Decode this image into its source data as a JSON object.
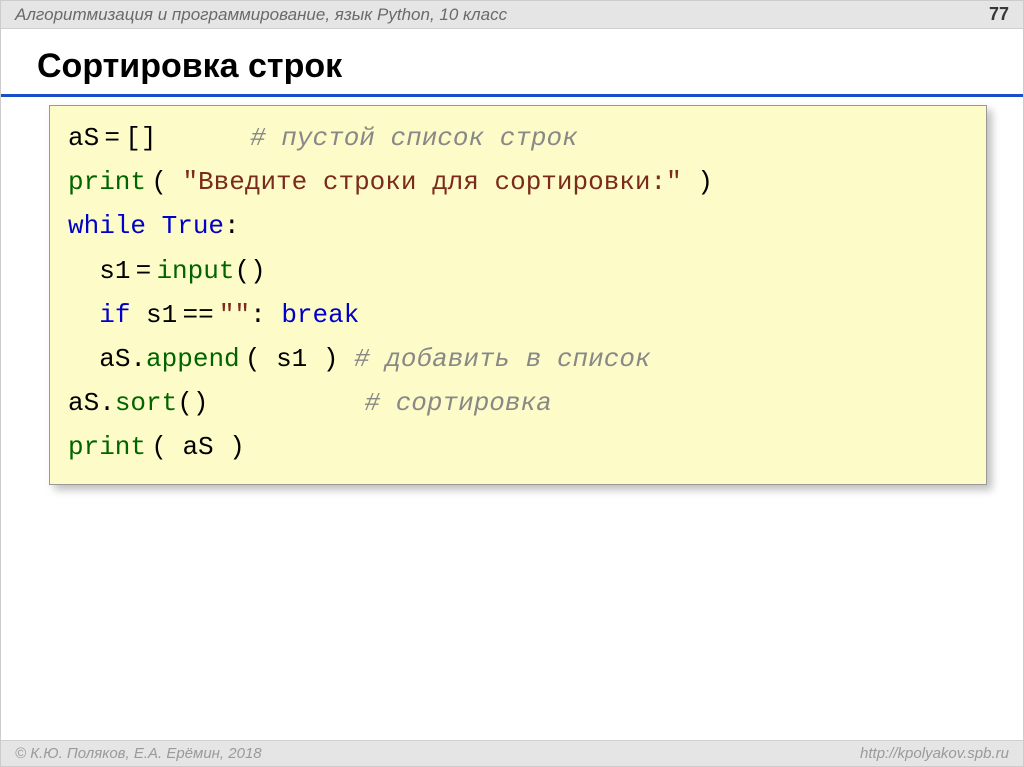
{
  "header": {
    "title": "Алгоритмизация и программирование, язык Python, 10 класс",
    "page": "77"
  },
  "title": "Сортировка строк",
  "code": {
    "l1a": "aS",
    "l1b": "=",
    "l1c": "[]",
    "l1cmt": "# пустой список строк",
    "l2fn": "print",
    "l2p1": "(",
    "l2str": "\"Введите строки для сортировки:\"",
    "l2p2": ")",
    "l3kw": "while",
    "l3tr": "True",
    "l3c": ":",
    "l4a": "s1",
    "l4eq": "=",
    "l4fn": "input",
    "l4p": "()",
    "l5if": "if",
    "l5a": "s1",
    "l5eq": "==",
    "l5str": "\"\"",
    "l5c": ":",
    "l5br": "break",
    "l6a": "aS.",
    "l6fn": "append",
    "l6p1": "( ",
    "l6b": "s1",
    "l6p2": " )",
    "l6cmt": "# добавить в список",
    "l7a": "aS.",
    "l7fn": "sort",
    "l7p": "()",
    "l7cmt": "# сортировка",
    "l8fn": "print",
    "l8p1": "( ",
    "l8a": "aS",
    "l8p2": " )"
  },
  "footer": {
    "left": "© К.Ю. Поляков, Е.А. Ерёмин, 2018",
    "right": "http://kpolyakov.spb.ru"
  }
}
